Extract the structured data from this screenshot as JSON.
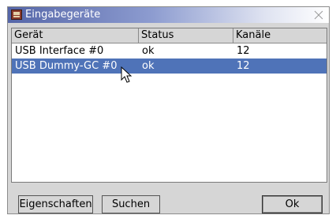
{
  "window": {
    "title": "Eingabegeräte"
  },
  "table": {
    "columns": [
      "Gerät",
      "Status",
      "Kanäle"
    ],
    "rows": [
      [
        "USB Interface #0",
        "ok",
        "12"
      ],
      [
        "USB Dummy-GC #0",
        "ok",
        "12"
      ]
    ],
    "selected_row": 1,
    "selection_color": "#4f73b8"
  },
  "buttons": {
    "properties": "Eigenschaften",
    "search": "Suchen",
    "ok": "Ok"
  },
  "colors": {
    "title_gradient_start": "#5566a8",
    "window_bg": "#d6d6d6"
  }
}
